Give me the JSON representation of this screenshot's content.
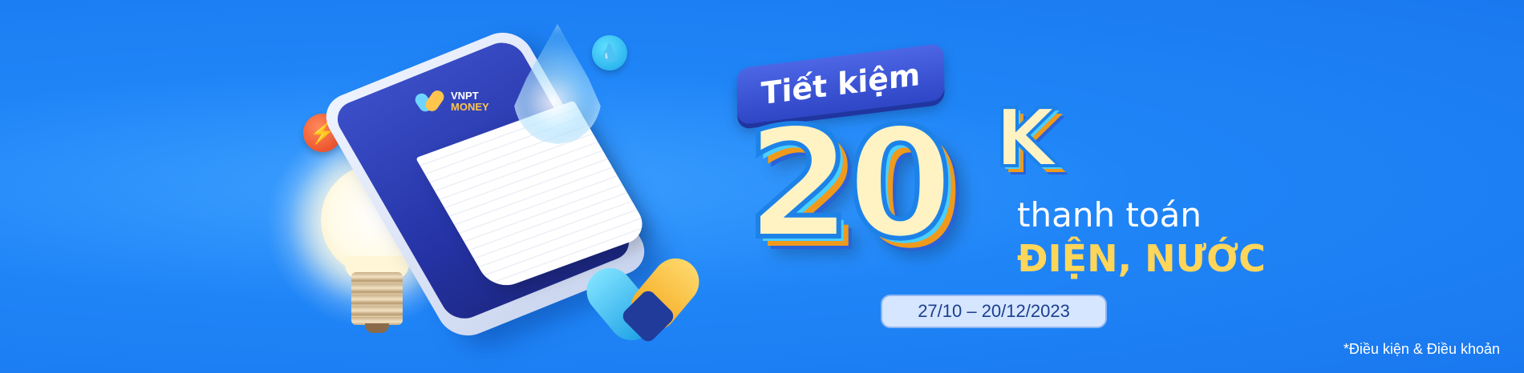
{
  "brand": {
    "name_line1": "VNPT",
    "name_line2": "MONEY"
  },
  "promo": {
    "ribbon": "Tiết kiệm",
    "amount": "20",
    "amount_unit": "K",
    "line1": "thanh toán",
    "line2": "ĐIỆN, NƯỚC",
    "date_range": "27/10 – 20/12/2023",
    "terms_link": "*Điều kiện & Điều khoản"
  },
  "icons": {
    "bolt": "lightning-icon",
    "drop": "water-drop-icon"
  },
  "colors": {
    "background": "#1f85f7",
    "accent_yellow": "#ffd65a",
    "pill_bg": "#d6e6ff"
  }
}
